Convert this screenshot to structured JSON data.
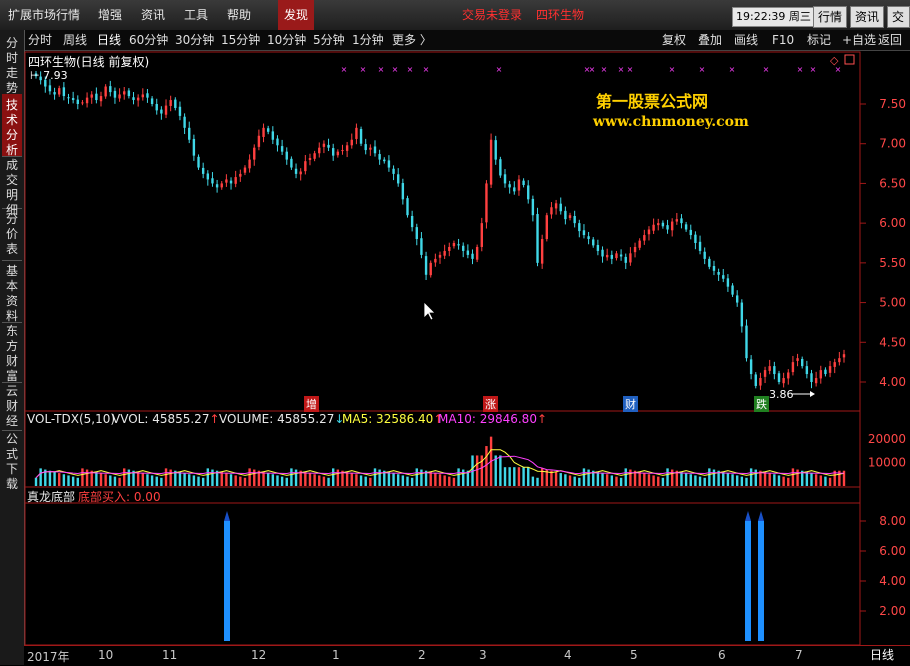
{
  "menu": {
    "items": [
      "扩展市场行情",
      "增强",
      "资讯",
      "工具",
      "帮助"
    ],
    "active": "发现",
    "status": "交易未登录",
    "stock": "四环生物",
    "clock": "19:22:39",
    "weekday": "周三",
    "buttons": [
      "行情",
      "资讯",
      "交易"
    ]
  },
  "periods": [
    "分时",
    "周线",
    "日线",
    "60分钟",
    "30分钟",
    "15分钟",
    "10分钟",
    "5分钟",
    "1分钟",
    "更多 〉"
  ],
  "active_period": "日线",
  "toolbar_right": [
    "复权",
    "叠加",
    "画线",
    "F10",
    "标记",
    "+自选",
    "返回"
  ],
  "side_tabs": [
    "分时走势",
    "技术分析",
    "成交明细",
    "分价表",
    "基本资料",
    "东方财富",
    "云财经",
    "公式下载"
  ],
  "active_side_tab": "技术分析",
  "main": {
    "title": "四环生物(日线 前复权)",
    "high_label": "7.93",
    "low_label": "3.86",
    "watermark_cn": "第一股票公式网",
    "watermark_url": "www.chnmoney.com",
    "events": [
      {
        "label": "增",
        "color": "#c01818"
      },
      {
        "label": "涨",
        "color": "#c01818"
      },
      {
        "label": "财",
        "color": "#2060c0"
      },
      {
        "label": "跌",
        "color": "#208020"
      }
    ]
  },
  "volume": {
    "name": "VOL-TDX(5,10)",
    "vvol": "VVOL: 45855.27",
    "volume": "VOLUME: 45855.27",
    "ma5": "MA5: 32586.40",
    "ma10": "MA10: 29846.80"
  },
  "indicator": {
    "name": "真龙底部",
    "signal": "底部买入: 0.00"
  },
  "bottom_tab": "日线",
  "colors": {
    "up": "#ff4040",
    "down": "#40d8e8",
    "ma5": "#ffff40",
    "ma10": "#ff40ff"
  },
  "chart_data": [
    {
      "type": "candlestick",
      "y_ticks": [
        "7.50",
        "7.00",
        "6.50",
        "6.00",
        "5.50",
        "5.00",
        "4.50",
        "4.00"
      ],
      "x_ticks": [
        "2017年",
        "10",
        "11",
        "12",
        "1",
        "2",
        "3",
        "4",
        "5",
        "6",
        "7"
      ],
      "close": [
        7.85,
        7.8,
        7.72,
        7.66,
        7.62,
        7.7,
        7.6,
        7.58,
        7.55,
        7.5,
        7.52,
        7.58,
        7.62,
        7.55,
        7.6,
        7.72,
        7.65,
        7.58,
        7.62,
        7.66,
        7.6,
        7.55,
        7.58,
        7.62,
        7.58,
        7.5,
        7.42,
        7.38,
        7.48,
        7.55,
        7.45,
        7.35,
        7.2,
        7.05,
        6.85,
        6.7,
        6.62,
        6.55,
        6.5,
        6.45,
        6.5,
        6.55,
        6.5,
        6.58,
        6.62,
        6.7,
        6.8,
        6.95,
        7.1,
        7.2,
        7.15,
        7.05,
        6.98,
        6.9,
        6.8,
        6.7,
        6.62,
        6.65,
        6.78,
        6.82,
        6.88,
        6.95,
        7.0,
        6.95,
        6.85,
        6.9,
        6.92,
        6.98,
        7.05,
        7.2,
        7.0,
        6.92,
        6.95,
        6.88,
        6.8,
        6.78,
        6.7,
        6.62,
        6.5,
        6.3,
        6.1,
        5.95,
        5.8,
        5.6,
        5.35,
        5.5,
        5.55,
        5.6,
        5.65,
        5.7,
        5.75,
        5.72,
        5.65,
        5.6,
        5.55,
        5.7,
        6.0,
        6.5,
        7.05,
        6.8,
        6.6,
        6.5,
        6.45,
        6.4,
        6.55,
        6.48,
        6.3,
        6.1,
        5.5,
        5.8,
        6.1,
        6.2,
        6.25,
        6.15,
        6.05,
        6.1,
        6.0,
        5.9,
        5.85,
        5.8,
        5.72,
        5.65,
        5.58,
        5.6,
        5.55,
        5.62,
        5.58,
        5.5,
        5.62,
        5.7,
        5.78,
        5.85,
        5.92,
        5.98,
        6.0,
        5.96,
        5.92,
        6.02,
        6.05,
        6.0,
        5.92,
        5.85,
        5.75,
        5.65,
        5.55,
        5.45,
        5.4,
        5.35,
        5.3,
        5.2,
        5.1,
        5.0,
        4.7,
        4.3,
        4.1,
        3.95,
        4.05,
        4.15,
        4.2,
        4.1,
        4.0,
        4.05,
        4.12,
        4.25,
        4.3,
        4.2,
        4.1,
        4.0,
        4.05,
        4.15,
        4.1,
        4.2,
        4.25,
        4.3,
        4.35
      ],
      "volume_ticks": [
        "20000",
        "10000"
      ],
      "signal_ticks": [
        "8.00",
        "6.00",
        "4.00",
        "2.00"
      ],
      "signal_values": [
        8,
        8,
        8
      ],
      "signal_positions": [
        "11月末",
        "6月末",
        "6月末"
      ]
    }
  ]
}
